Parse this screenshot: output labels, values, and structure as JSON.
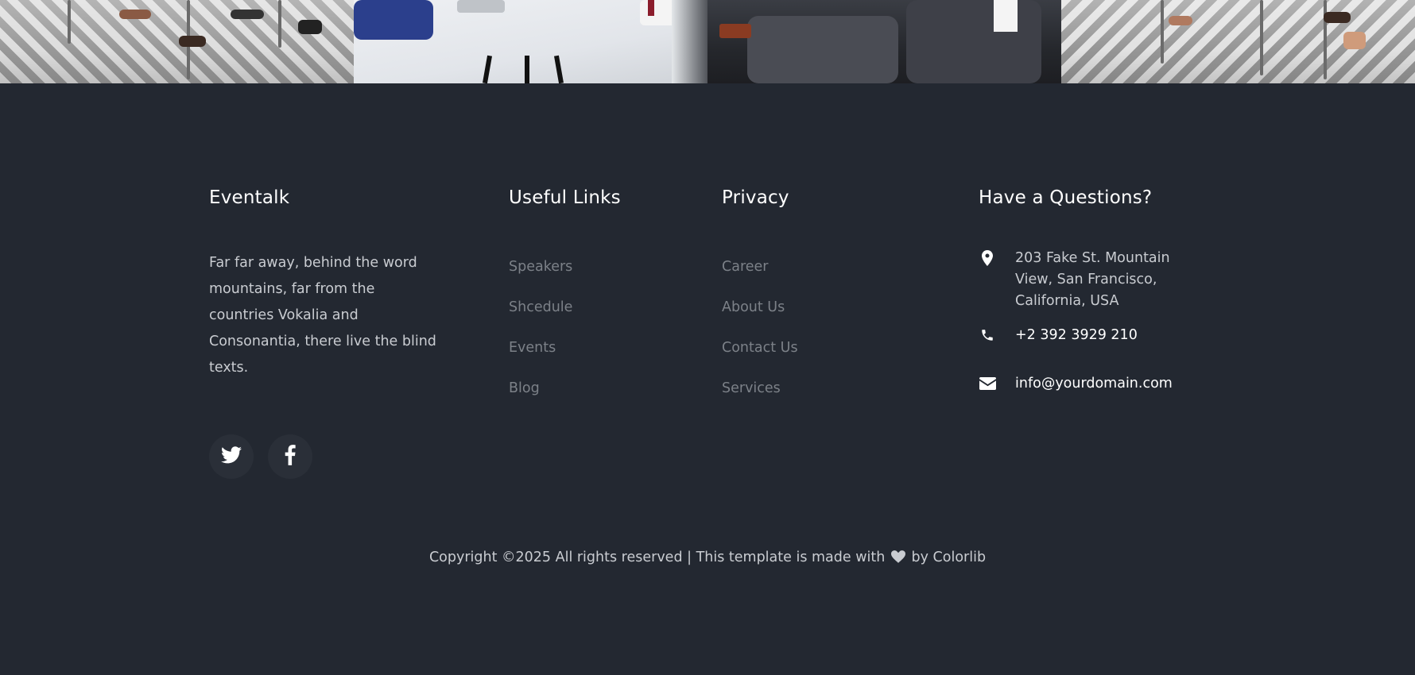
{
  "footer": {
    "brand": {
      "title": "Eventalk",
      "description": "Far far away, behind the word mountains, far from the countries Vokalia and Consonantia, there live the blind texts."
    },
    "useful_links": {
      "title": "Useful Links",
      "items": [
        "Speakers",
        "Shcedule",
        "Events",
        "Blog"
      ]
    },
    "privacy": {
      "title": "Privacy",
      "items": [
        "Career",
        "About Us",
        "Contact Us",
        "Services"
      ]
    },
    "contact": {
      "title": "Have a Questions?",
      "address": "203 Fake St. Mountain View, San Francisco, California, USA",
      "phone": "+2 392 3929 210",
      "email": "info@yourdomain.com"
    },
    "social": [
      {
        "name": "twitter",
        "icon": "twitter-icon"
      },
      {
        "name": "facebook",
        "icon": "facebook-icon"
      }
    ],
    "copyright": {
      "before": "Copyright ©2025 All rights reserved | This template is made with",
      "after": "by Colorlib"
    }
  },
  "colors": {
    "background": "#232831",
    "heading": "#ffffff",
    "body_text": "#c9ccd1",
    "link_text": "#7c8188",
    "social_bg": "#2a2f38"
  }
}
